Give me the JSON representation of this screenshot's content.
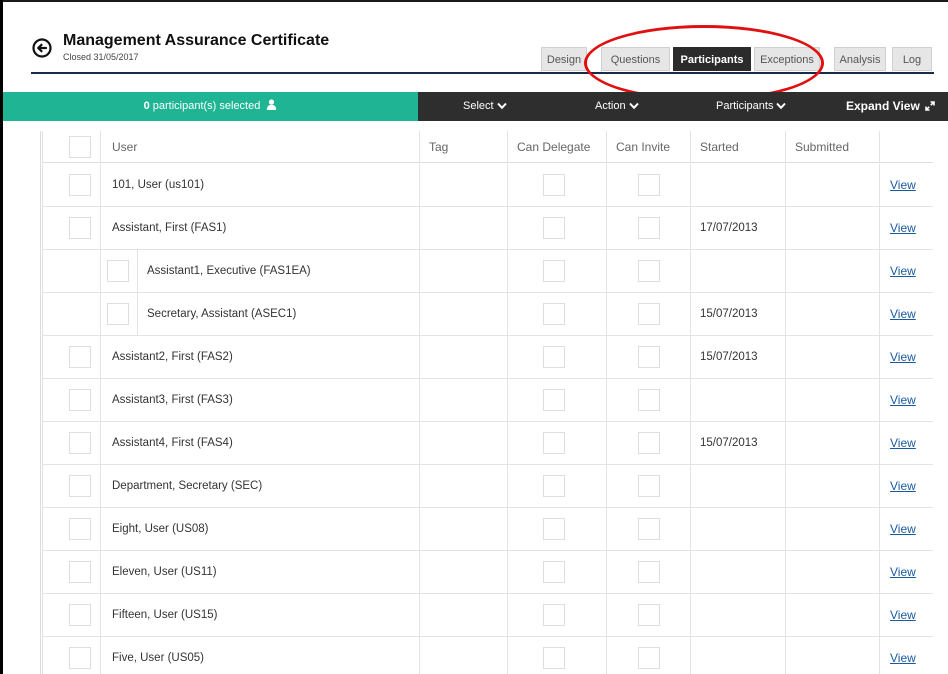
{
  "header": {
    "title": "Management Assurance Certificate",
    "subtitle": "Closed 31/05/2017"
  },
  "tabs": [
    {
      "label": "Design",
      "active": false
    },
    {
      "label": "Questions",
      "active": false
    },
    {
      "label": "Participants",
      "active": true
    },
    {
      "label": "Exceptions",
      "active": false
    },
    {
      "label": "Analysis",
      "active": false
    },
    {
      "label": "Log",
      "active": false
    }
  ],
  "toolbar": {
    "selected_count": "0",
    "selected_suffix": " participant(s) selected",
    "select_label": "Select",
    "action_label": "Action",
    "participants_label": "Participants",
    "expand_label": "Expand View"
  },
  "table": {
    "columns": [
      "User",
      "Tag",
      "Can Delegate",
      "Can Invite",
      "Started",
      "Submitted",
      ""
    ],
    "rows": [
      {
        "user": "101, User (us101)",
        "tag": "",
        "started": "",
        "submitted": "",
        "view": "View",
        "indent": false
      },
      {
        "user": "Assistant, First (FAS1)",
        "tag": "",
        "started": "17/07/2013",
        "submitted": "",
        "view": "View",
        "indent": false
      },
      {
        "user": "Assistant1, Executive (FAS1EA)",
        "tag": "",
        "started": "",
        "submitted": "",
        "view": "View",
        "indent": true
      },
      {
        "user": "Secretary, Assistant (ASEC1)",
        "tag": "",
        "started": "15/07/2013",
        "submitted": "",
        "view": "View",
        "indent": true
      },
      {
        "user": "Assistant2, First (FAS2)",
        "tag": "",
        "started": "15/07/2013",
        "submitted": "",
        "view": "View",
        "indent": false
      },
      {
        "user": "Assistant3, First (FAS3)",
        "tag": "",
        "started": "",
        "submitted": "",
        "view": "View",
        "indent": false
      },
      {
        "user": "Assistant4, First (FAS4)",
        "tag": "",
        "started": "15/07/2013",
        "submitted": "",
        "view": "View",
        "indent": false
      },
      {
        "user": "Department, Secretary (SEC)",
        "tag": "",
        "started": "",
        "submitted": "",
        "view": "View",
        "indent": false
      },
      {
        "user": "Eight, User (US08)",
        "tag": "",
        "started": "",
        "submitted": "",
        "view": "View",
        "indent": false
      },
      {
        "user": "Eleven, User (US11)",
        "tag": "",
        "started": "",
        "submitted": "",
        "view": "View",
        "indent": false
      },
      {
        "user": "Fifteen, User (US15)",
        "tag": "",
        "started": "",
        "submitted": "",
        "view": "View",
        "indent": false
      },
      {
        "user": "Five, User (US05)",
        "tag": "",
        "started": "",
        "submitted": "",
        "view": "View",
        "indent": false
      }
    ]
  },
  "icons": {
    "back": "back-arrow-circle-icon",
    "user": "user-icon",
    "chevron": "chevron-down-icon",
    "expand": "expand-arrows-icon"
  },
  "colors": {
    "accent": "#1fb493",
    "toolbar": "#2e2e2e",
    "active_tab": "#2b2b2b",
    "link": "#1a5aa0",
    "highlight": "#e01010"
  }
}
